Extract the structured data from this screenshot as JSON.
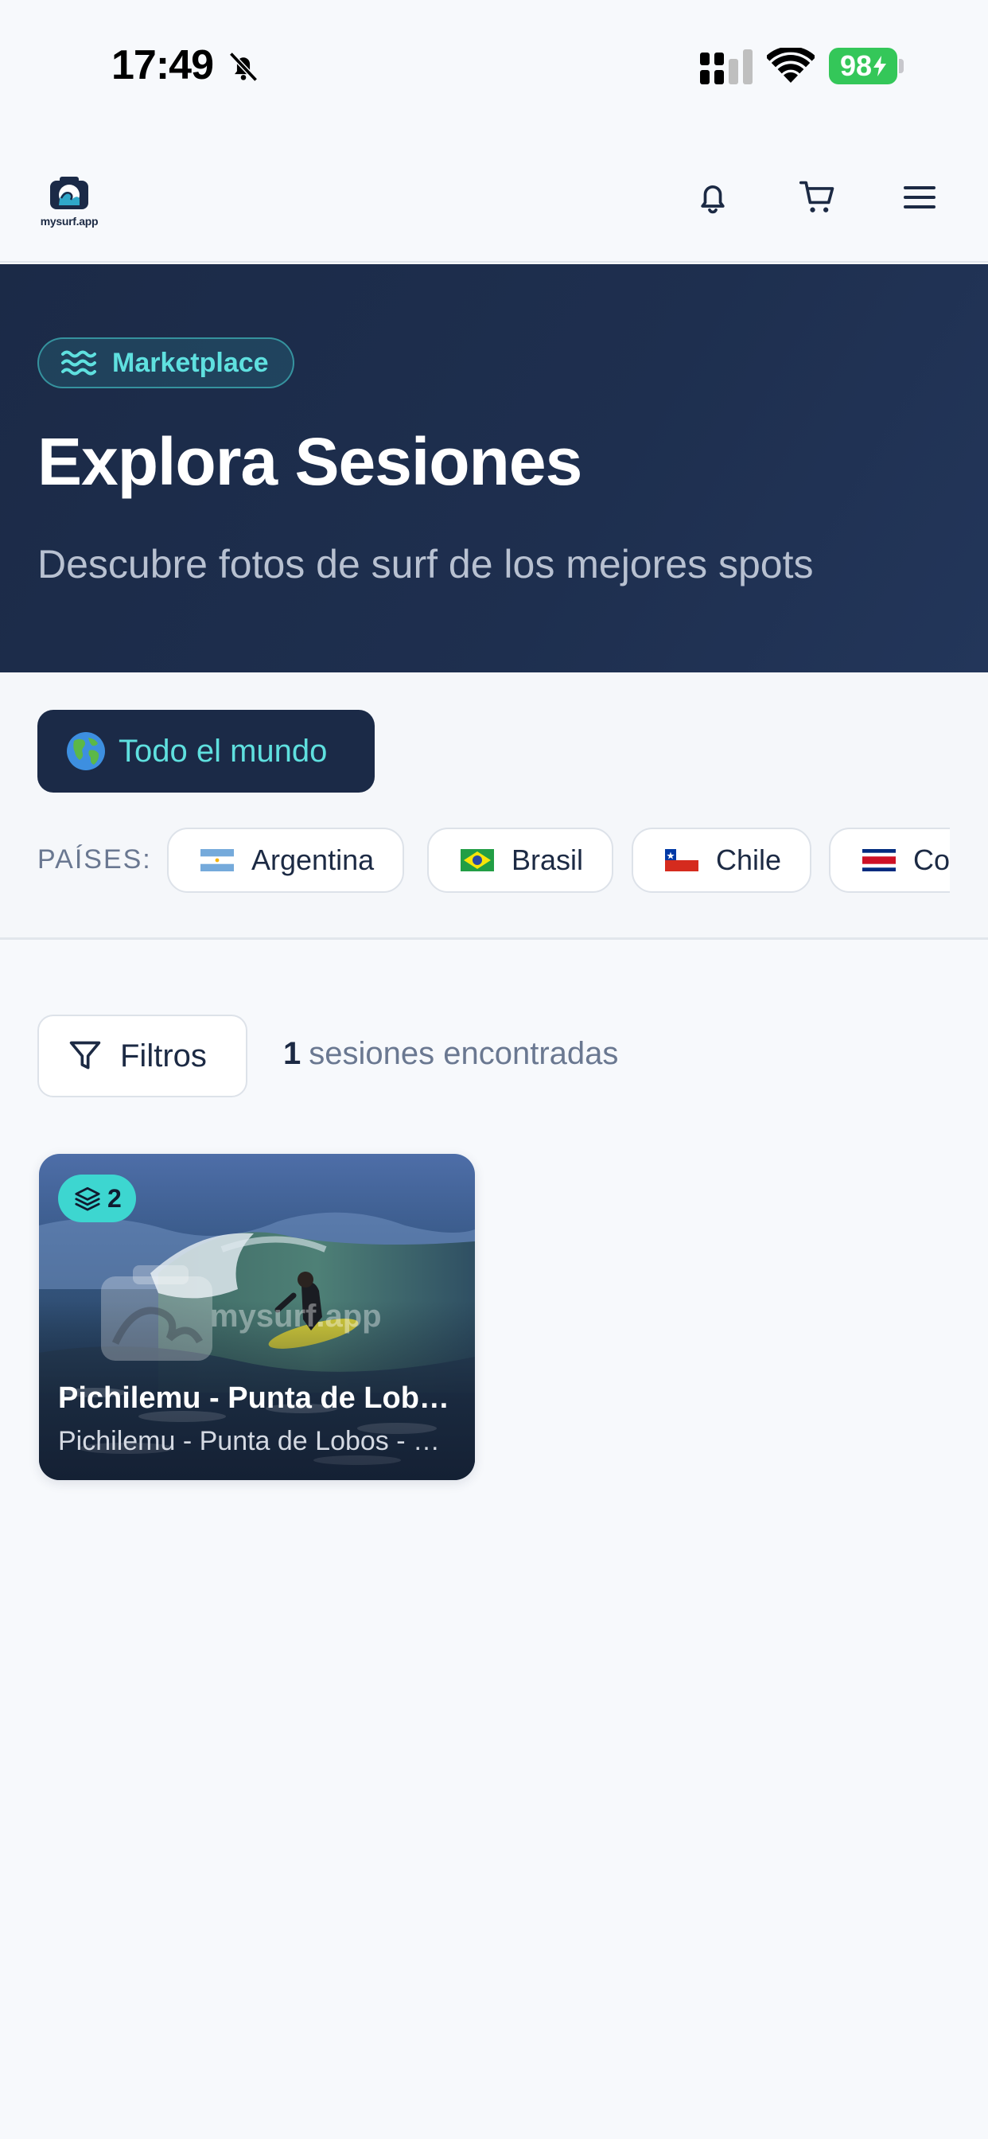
{
  "status_bar": {
    "time": "17:49",
    "battery": "98",
    "icons": [
      "bell-slash-icon",
      "signal-icon",
      "wifi-icon",
      "battery-charging-icon"
    ]
  },
  "nav": {
    "logo_text": "mysurf.app",
    "icons": [
      "bell-icon",
      "cart-icon",
      "menu-icon"
    ]
  },
  "hero": {
    "badge_label": "Marketplace",
    "title": "Explora Sesiones",
    "subtitle": "Descubre fotos de surf de los mejores spots"
  },
  "location_filter": {
    "world_button": "Todo el mundo",
    "countries_label": "PAÍSES:",
    "countries": [
      {
        "label": "Argentina",
        "flag": "argentina"
      },
      {
        "label": "Brasil",
        "flag": "brazil"
      },
      {
        "label": "Chile",
        "flag": "chile"
      },
      {
        "label": "Costa Rica",
        "flag": "costa-rica"
      }
    ]
  },
  "results": {
    "filters_label": "Filtros",
    "count": "1",
    "suffix": "sesiones encontradas"
  },
  "sessions": [
    {
      "photo_count": "2",
      "watermark": "mysurf.app",
      "title": "Pichilemu - Punta de Lobos - Chile",
      "subtitle": "Pichilemu - Punta de Lobos - Chile"
    }
  ],
  "colors": {
    "navy": "#1b2a47",
    "accent_teal": "#5fe0df",
    "badge_teal": "#3dd6d0",
    "battery_green": "#34c759",
    "page_bg": "#f7f9fc"
  }
}
